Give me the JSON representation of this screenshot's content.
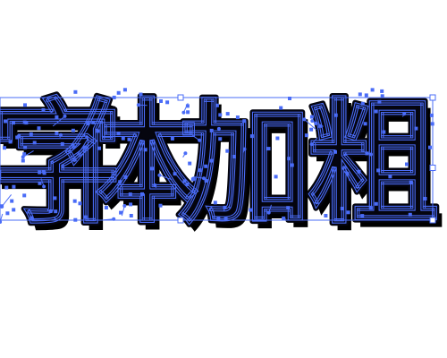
{
  "artwork": {
    "text": "字体加粗",
    "fill_color": "#05050f",
    "shadow_color": "#000000",
    "path_color": "#4a6cf7",
    "anchor_color": "#4a6cf7",
    "handle_fill": "#ffffff",
    "selection_color": "#4a6cf7"
  }
}
